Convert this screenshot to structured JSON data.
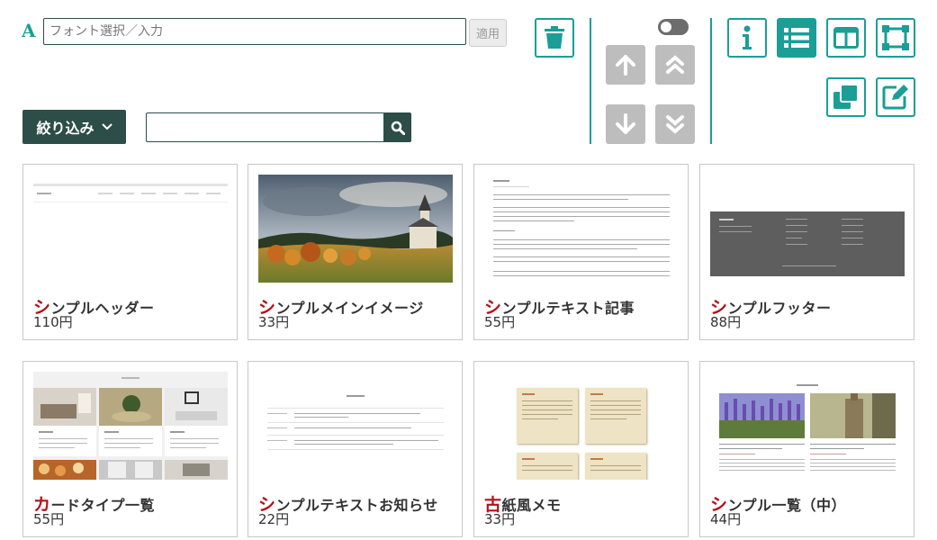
{
  "toolbar": {
    "font_icon": "A",
    "font_placeholder": "フォント選択／入力",
    "apply_label": "適用",
    "filter_label": "絞り込み",
    "search_placeholder": "",
    "toggle_on": false
  },
  "icons": {
    "delete": "trash-icon",
    "info": "info-icon",
    "list": "list-view-icon",
    "columns": "column-layout-icon",
    "frame": "frame-select-icon",
    "duplicate": "duplicate-icon",
    "edit": "edit-icon",
    "up": "arrow-up-icon",
    "top": "double-chevron-up-icon",
    "down": "arrow-down-icon",
    "bottom": "double-chevron-down-icon"
  },
  "colors": {
    "accent": "#1a9e96",
    "dark": "#2d4d48",
    "title_first_char": "#b3121b",
    "disabled": "#bdbdbd"
  },
  "cards": [
    {
      "first": "シ",
      "rest": "ンプルヘッダー",
      "price": "110円"
    },
    {
      "first": "シ",
      "rest": "ンプルメインイメージ",
      "price": "33円"
    },
    {
      "first": "シ",
      "rest": "ンプルテキスト記事",
      "price": "55円"
    },
    {
      "first": "シ",
      "rest": "ンプルフッター",
      "price": "88円"
    },
    {
      "first": "カ",
      "rest": "ードタイプ一覧",
      "price": "55円"
    },
    {
      "first": "シ",
      "rest": "ンプルテキストお知らせ",
      "price": "22円"
    },
    {
      "first": "古",
      "rest": "紙風メモ",
      "price": "33円"
    },
    {
      "first": "シ",
      "rest": "ンプル一覧（中）",
      "price": "44円"
    }
  ]
}
